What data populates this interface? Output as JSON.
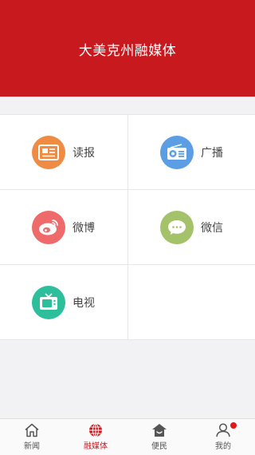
{
  "header": {
    "title": "大美克州融媒体"
  },
  "colors": {
    "brand": "#c8191f",
    "read_icon": "#ef8b43",
    "radio_icon": "#5b9ee3",
    "weibo_icon": "#ef6a6a",
    "wechat_icon": "#a4c26a",
    "tv_icon": "#2dbf9c",
    "badge": "#e01818"
  },
  "grid": {
    "items": [
      {
        "label": "读报",
        "icon": "newspaper-icon"
      },
      {
        "label": "广播",
        "icon": "radio-icon"
      },
      {
        "label": "微博",
        "icon": "weibo-icon"
      },
      {
        "label": "微信",
        "icon": "wechat-icon"
      },
      {
        "label": "电视",
        "icon": "tv-icon"
      }
    ]
  },
  "tabbar": {
    "active": 1,
    "tabs": [
      {
        "label": "新闻",
        "icon": "home-icon"
      },
      {
        "label": "融媒体",
        "icon": "globe-icon"
      },
      {
        "label": "便民",
        "icon": "house-service-icon"
      },
      {
        "label": "我的",
        "icon": "user-icon",
        "badge": true
      }
    ]
  }
}
